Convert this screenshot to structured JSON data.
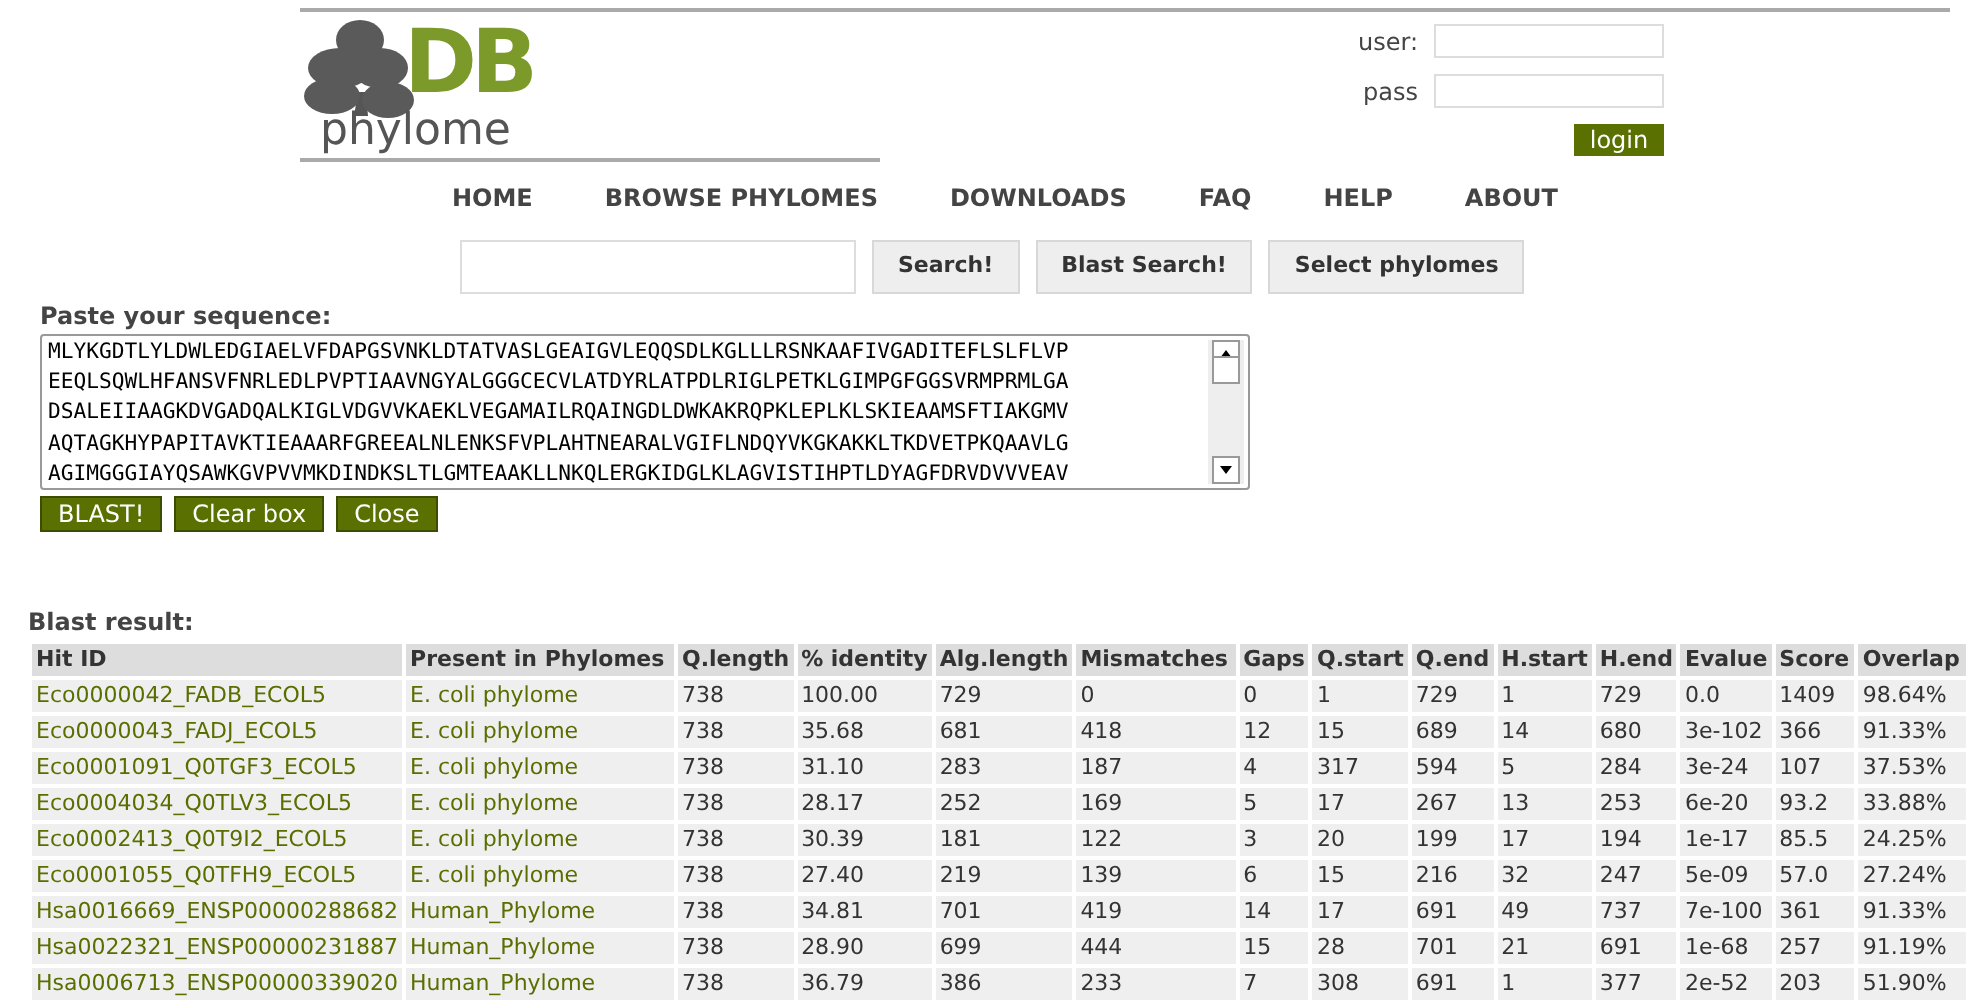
{
  "logo": {
    "mark": "DB",
    "name": "phylome"
  },
  "login": {
    "user_label": "user:",
    "pass_label": "pass",
    "button": "login"
  },
  "nav": [
    "HOME",
    "BROWSE PHYLOMES",
    "DOWNLOADS",
    "FAQ",
    "HELP",
    "ABOUT"
  ],
  "search": {
    "buttons": [
      "Search!",
      "Blast Search!",
      "Select phylomes"
    ]
  },
  "sequence": {
    "label": "Paste your sequence:",
    "lines": [
      "MLYKGDTLYLDWLEDGIAELVFDAPGSVNKLDTATVASLGEAIGVLEQQSDLKGLLLRSNKAAFIVGADITEFLSLFLVP",
      "EEQLSQWLHFANSVFNRLEDLPVPTIAAVNGYALGGGCECVLATDYRLATPDLRIGLPETKLGIMPGFGGSVRMPRMLGA",
      "DSALEIIAAGKDVGADQALKIGLVDGVVKAEKLVEGAMAILRQAINGDLDWKAKRQPKLEPLKLSKIEAAMSFTIAKGMV",
      "AQTAGKHYPAPITAVKTIEAAARFGREEALNLENKSFVPLAHTNEARALVGIFLNDQYVKGKAKKLTKDVETPKQAAVLG",
      "AGIMGGGIAYQSAWKGVPVVMKDINDKSLTLGMTEAAKLLNKQLERGKIDGLKLAGVISTIHPTLDYAGFDRVDVVVEAV"
    ],
    "buttons": [
      "BLAST!",
      "Clear box",
      "Close"
    ]
  },
  "blast_result": {
    "title": "Blast result:",
    "columns": [
      "Hit ID",
      "Present in Phylomes",
      "Q.length",
      "% identity",
      "Alg.length",
      "Mismatches",
      "Gaps",
      "Q.start",
      "Q.end",
      "H.start",
      "H.end",
      "Evalue",
      "Score",
      "Overlap"
    ],
    "rows": [
      [
        "Eco0000042_FADB_ECOL5",
        "E. coli phylome",
        "738",
        "100.00",
        "729",
        "0",
        "0",
        "1",
        "729",
        "1",
        "729",
        "0.0",
        "1409",
        "98.64%"
      ],
      [
        "Eco0000043_FADJ_ECOL5",
        "E. coli phylome",
        "738",
        "35.68",
        "681",
        "418",
        "12",
        "15",
        "689",
        "14",
        "680",
        "3e-102",
        "366",
        "91.33%"
      ],
      [
        "Eco0001091_Q0TGF3_ECOL5",
        "E. coli phylome",
        "738",
        "31.10",
        "283",
        "187",
        "4",
        "317",
        "594",
        "5",
        "284",
        "3e-24",
        "107",
        "37.53%"
      ],
      [
        "Eco0004034_Q0TLV3_ECOL5",
        "E. coli phylome",
        "738",
        "28.17",
        "252",
        "169",
        "5",
        "17",
        "267",
        "13",
        "253",
        "6e-20",
        "93.2",
        "33.88%"
      ],
      [
        "Eco0002413_Q0T9I2_ECOL5",
        "E. coli phylome",
        "738",
        "30.39",
        "181",
        "122",
        "3",
        "20",
        "199",
        "17",
        "194",
        "1e-17",
        "85.5",
        "24.25%"
      ],
      [
        "Eco0001055_Q0TFH9_ECOL5",
        "E. coli phylome",
        "738",
        "27.40",
        "219",
        "139",
        "6",
        "15",
        "216",
        "32",
        "247",
        "5e-09",
        "57.0",
        "27.24%"
      ],
      [
        "Hsa0016669_ENSP00000288682",
        "Human_Phylome",
        "738",
        "34.81",
        "701",
        "419",
        "14",
        "17",
        "691",
        "49",
        "737",
        "7e-100",
        "361",
        "91.33%"
      ],
      [
        "Hsa0022321_ENSP00000231887",
        "Human_Phylome",
        "738",
        "28.90",
        "699",
        "444",
        "15",
        "28",
        "701",
        "21",
        "691",
        "1e-68",
        "257",
        "91.19%"
      ],
      [
        "Hsa0006713_ENSP00000339020",
        "Human_Phylome",
        "738",
        "36.79",
        "386",
        "233",
        "7",
        "308",
        "691",
        "1",
        "377",
        "2e-52",
        "203",
        "51.90%"
      ]
    ]
  }
}
